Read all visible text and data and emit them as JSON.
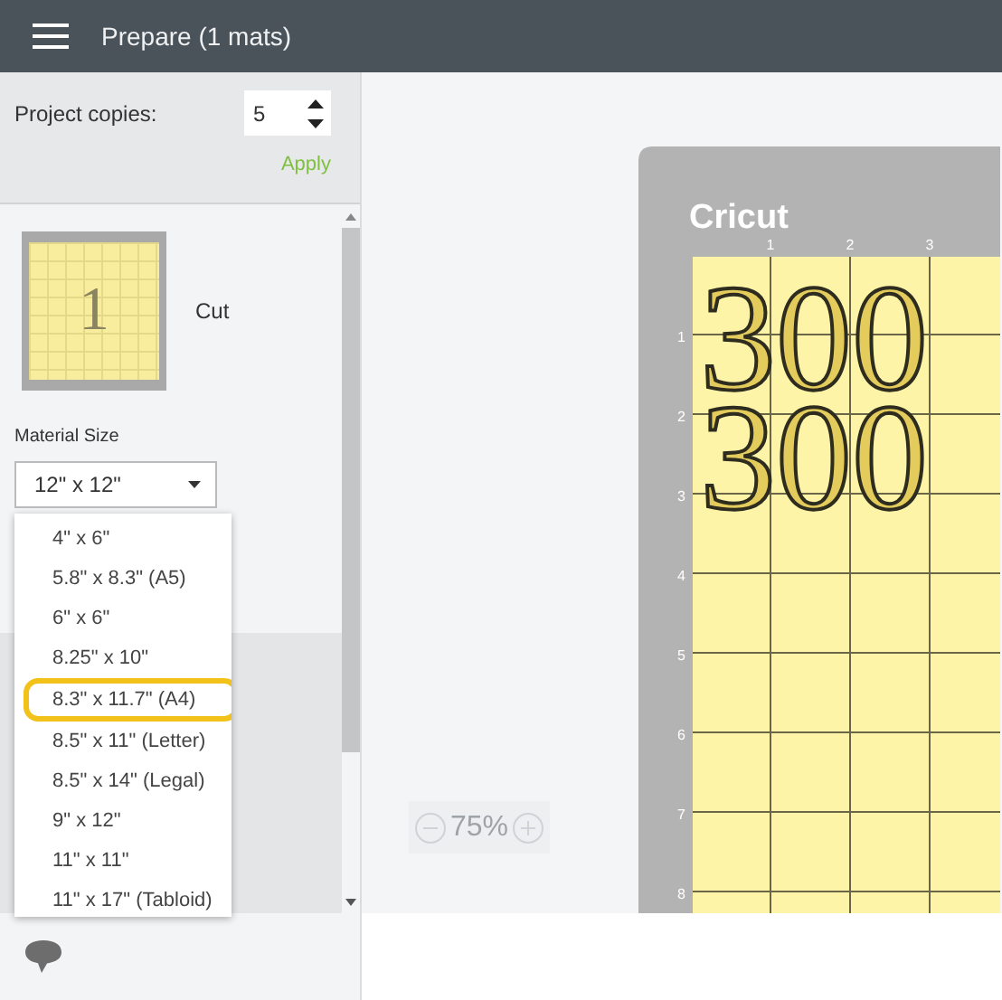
{
  "header": {
    "title": "Prepare (1 mats)"
  },
  "copies": {
    "label": "Project copies:",
    "value": "5"
  },
  "apply": "Apply",
  "mat_item": {
    "number": "1",
    "label": "Cut"
  },
  "material_size": {
    "label": "Material Size",
    "value": "12\" x 12\"",
    "options": [
      {
        "label": "4\" x 6\"",
        "selected": false
      },
      {
        "label": "5.8\" x 8.3\" (A5)",
        "selected": false
      },
      {
        "label": "6\" x 6\"",
        "selected": false
      },
      {
        "label": "8.25\" x 10\"",
        "selected": false
      },
      {
        "label": "8.3\" x 11.7\" (A4)",
        "selected": true
      },
      {
        "label": "8.5\" x 11\" (Letter)",
        "selected": false
      },
      {
        "label": "8.5\" x 14\" (Legal)",
        "selected": false
      },
      {
        "label": "9\" x 12\"",
        "selected": false
      },
      {
        "label": "11\" x 11\"",
        "selected": false
      },
      {
        "label": "11\" x 17\" (Tabloid)",
        "selected": false
      }
    ]
  },
  "mat": {
    "logo": "Cricut",
    "column_labels": [
      "1",
      "2",
      "3"
    ],
    "row_labels": [
      "1",
      "2",
      "3",
      "4",
      "5",
      "6",
      "7",
      "8"
    ],
    "design_lines": [
      "300",
      "300"
    ]
  },
  "zoom": {
    "value": "75%"
  }
}
